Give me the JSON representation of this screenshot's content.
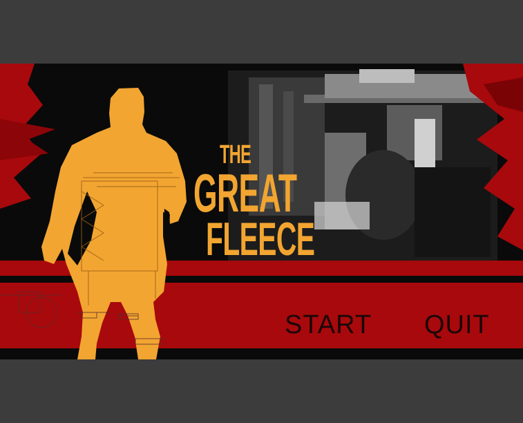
{
  "game": {
    "title_line1": "THE",
    "title_line2": "GREAT",
    "title_line3": "FLEECE"
  },
  "menu": {
    "items": [
      {
        "label": "START"
      },
      {
        "label": "QUIT"
      }
    ]
  },
  "colors": {
    "accent_orange": "#f2a531",
    "stripe_red": "#a8090c",
    "letterbox_gray": "#3c3c3c",
    "background_black": "#0a0a0a"
  }
}
